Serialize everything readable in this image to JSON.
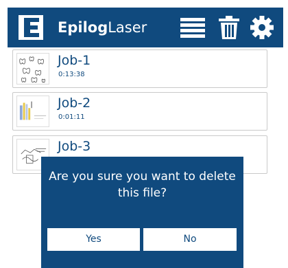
{
  "header": {
    "logo_bold": "Epilog",
    "logo_light": "Laser",
    "icons": [
      "logo-e-icon",
      "menu-icon",
      "trash-icon",
      "gear-icon"
    ],
    "color": "#104a7e"
  },
  "jobs": [
    {
      "name": "Job-1",
      "time": "0:13:38",
      "thumbnail": "butterflies-artwork"
    },
    {
      "name": "Job-2",
      "time": "0:01:11",
      "thumbnail": "colored-bars-artwork"
    },
    {
      "name": "Job-3",
      "time": "",
      "thumbnail": "line-drawing-artwork"
    }
  ],
  "dialog": {
    "message": "Are you sure you want to delete this file?",
    "yes_label": "Yes",
    "no_label": "No"
  }
}
